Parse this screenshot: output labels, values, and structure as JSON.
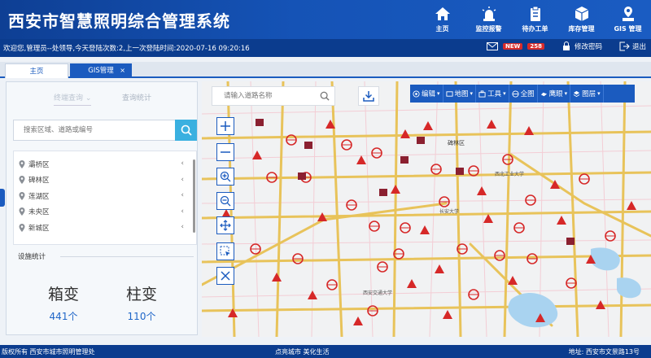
{
  "app": {
    "title": "西安市智慧照明综合管理系统"
  },
  "nav": [
    {
      "label": "主页",
      "icon": "home-icon"
    },
    {
      "label": "监控报警",
      "icon": "alarm-light-icon"
    },
    {
      "label": "待办工单",
      "icon": "clipboard-icon"
    },
    {
      "label": "库存管理",
      "icon": "cube-icon"
    },
    {
      "label": "GIS 管理",
      "icon": "map-pin-icon"
    }
  ],
  "infobar": {
    "welcome": "欢迎您,管理员--处领导,今天登陆次数:2,上一次登陆时间:2020-07-16 09:20:16",
    "new_badge": "NEW",
    "message_count": "258",
    "change_password": "修改密码",
    "logout": "退出"
  },
  "tabs": [
    {
      "label": "主页"
    },
    {
      "label": "GIS管理",
      "close": "×"
    }
  ],
  "panel": {
    "tab_active": "终端查询",
    "tab_inactive": "查询统计",
    "search_placeholder": "搜索区域、道路或编号",
    "districts": [
      "灞桥区",
      "碑林区",
      "莲湖区",
      "未央区",
      "新城区"
    ],
    "stats_title": "设施统计",
    "stats": [
      {
        "label": "箱变",
        "value": "441个"
      },
      {
        "label": "柱变",
        "value": "110个"
      }
    ]
  },
  "map": {
    "search_placeholder": "请输入道路名称",
    "toolbar": [
      {
        "label": "编辑",
        "icon": "edit-icon"
      },
      {
        "label": "地图",
        "icon": "map-icon"
      },
      {
        "label": "工具",
        "icon": "toolbox-icon"
      },
      {
        "label": "全图",
        "icon": "globe-icon"
      },
      {
        "label": "鹰眼",
        "icon": "eagle-eye-icon"
      },
      {
        "label": "图层",
        "icon": "layers-icon"
      }
    ],
    "controls": [
      "zoom-in",
      "zoom-out",
      "zoom-in-magnifier",
      "zoom-out-magnifier",
      "pan",
      "select",
      "clear"
    ],
    "labels": [
      "碑林区",
      "长安大学",
      "西安交通大学",
      "西北工业大学"
    ]
  },
  "footer": {
    "copyright": "版权所有   西安市城市照明管理处",
    "slogan": "点亮城市  美化生活",
    "address": "地址:  西安市文景路13号"
  },
  "colors": {
    "brand": "#1553b6",
    "accent": "#3ab0e0",
    "alarm_marker": "#d62828",
    "road": "#e8c35a"
  }
}
